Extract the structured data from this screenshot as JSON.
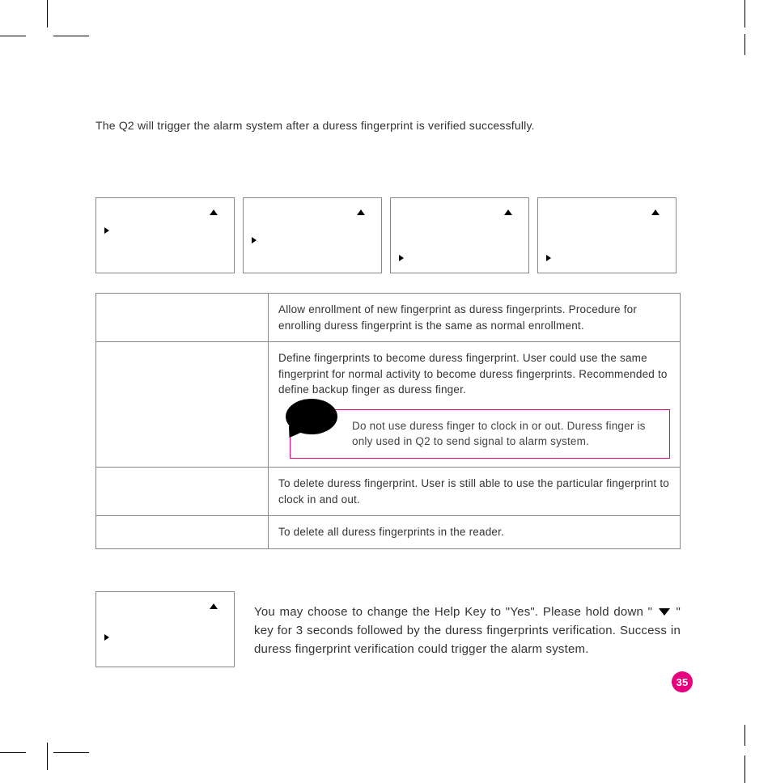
{
  "intro": "The Q2 will trigger the alarm system after a duress fingerprint is verified successfully.",
  "table": {
    "rows": [
      {
        "desc": "Allow enrollment of new fingerprint as duress fingerprints. Procedure for enrolling duress fingerprint is the same as normal enrollment."
      },
      {
        "desc": "Define fingerprints to become duress fingerprint. User could use the same fingerprint for normal activity to become duress fingerprints. Recommended to define backup finger as duress finger.",
        "callout": "Do not use duress finger to clock in or out. Duress finger is only used in Q2 to send signal to alarm system."
      },
      {
        "desc": "To delete duress fingerprint. User is still able to use the particular fingerprint to clock in and out."
      },
      {
        "desc": "To delete all duress fingerprints in the reader."
      }
    ]
  },
  "lower": {
    "pre": "You may choose to change the Help Key to \"Yes\". Please hold down \" ",
    "post": " \" key for 3 seconds followed by the duress fingerprints verification. Success in duress fingerprint verification could trigger the alarm system."
  },
  "page": "35",
  "icons": {
    "up": "triangle-up-icon",
    "right": "triangle-right-icon",
    "down": "triangle-down-icon",
    "speech": "speech-bubble-icon"
  }
}
